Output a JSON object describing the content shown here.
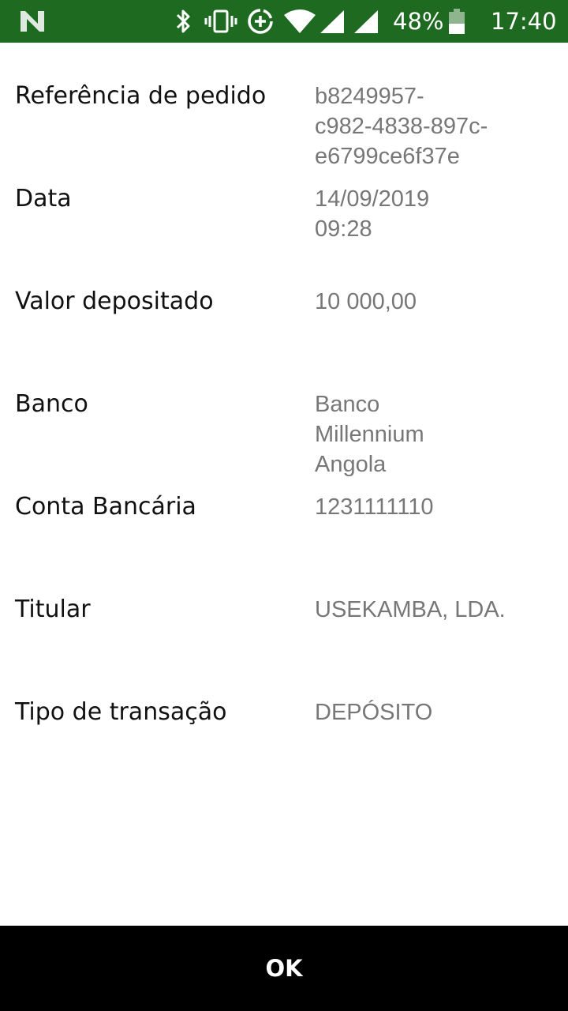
{
  "status_bar": {
    "battery": "48%",
    "time": "17:40",
    "icons": [
      "app-n-icon",
      "bluetooth-icon",
      "vibrate-icon",
      "data-saver-icon",
      "wifi-icon",
      "signal-icon",
      "signal-icon-2",
      "battery-icon"
    ]
  },
  "details": [
    {
      "label": "Referência de pedido",
      "value": "b8249957-\nc982-4838-897c-\ne6799ce6f37e"
    },
    {
      "label": "Data",
      "value": "14/09/2019\n09:28"
    },
    {
      "label": "Valor depositado",
      "value": "10 000,00"
    },
    {
      "label": "Banco",
      "value": "Banco\nMillennium\nAngola"
    },
    {
      "label": "Conta Bancária",
      "value": "1231111110"
    },
    {
      "label": "Titular",
      "value": "USEKAMBA, LDA."
    },
    {
      "label": "Tipo de transação",
      "value": "DEPÓSITO"
    }
  ],
  "ok_button": {
    "label": "OK"
  },
  "colors": {
    "status_bar": "#1e6a20",
    "label": "#111111",
    "value": "#777777",
    "ok_bar": "#000000"
  }
}
